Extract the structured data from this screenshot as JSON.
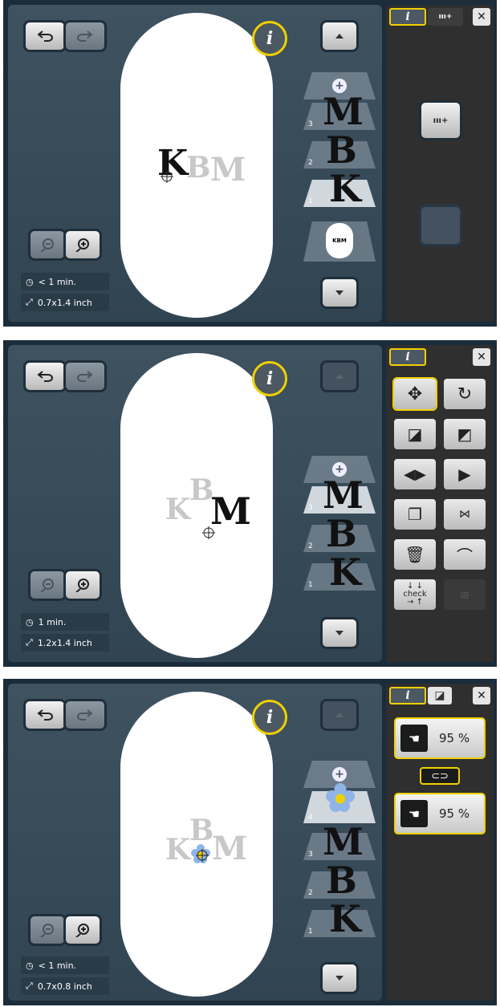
{
  "info_label": "i",
  "screens": [
    {
      "time": "< 1 min.",
      "size": "0.7x1.4 inch",
      "layers": [
        "3",
        "2",
        "1"
      ],
      "mini_label": "KBM",
      "letters": [
        "K",
        "B",
        "M"
      ],
      "right_button_label": "ııı+"
    },
    {
      "time": "1 min.",
      "size": "1.2x1.4 inch",
      "layers": [
        "3",
        "2",
        "1"
      ],
      "letters": [
        "K",
        "B",
        "M"
      ],
      "check_label": "check"
    },
    {
      "time": "< 1 min.",
      "size": "0.7x0.8 inch",
      "layers": [
        "4",
        "3",
        "2",
        "1"
      ],
      "letters": [
        "K",
        "B",
        "M"
      ],
      "scale_top": "95 %",
      "scale_bottom": "95 %"
    }
  ],
  "colors": {
    "accent": "#f0d000",
    "panel": "#1b2c3b",
    "hoop": "#ffffff"
  },
  "icons": [
    "undo-icon",
    "redo-icon",
    "zoom-out-icon",
    "zoom-in-icon",
    "clock-icon",
    "resize-icon",
    "arrow-up-icon",
    "arrow-down-icon",
    "close-icon",
    "move-icon",
    "rotate-icon",
    "scale-icon",
    "mirror-horizontal-icon",
    "mirror-vertical-icon",
    "delete-icon",
    "link-icon",
    "flower-icon"
  ]
}
